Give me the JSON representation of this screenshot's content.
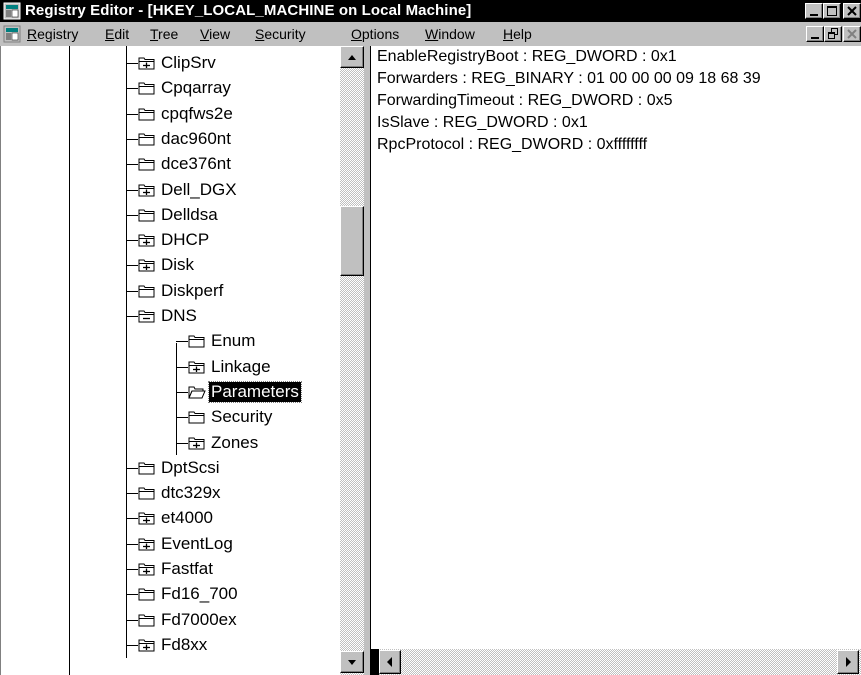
{
  "window": {
    "title": "Registry Editor - [HKEY_LOCAL_MACHINE on Local Machine]"
  },
  "menu": {
    "items": [
      {
        "label": "Registry",
        "accel": "R"
      },
      {
        "label": "Edit",
        "accel": "E"
      },
      {
        "label": "Tree",
        "accel": "T"
      },
      {
        "label": "View",
        "accel": "V"
      },
      {
        "label": "Security",
        "accel": "S"
      },
      {
        "label": "Options",
        "accel": "O"
      },
      {
        "label": "Window",
        "accel": "W"
      },
      {
        "label": "Help",
        "accel": "H"
      }
    ]
  },
  "tree": {
    "items": [
      {
        "label": "ClipSrv",
        "expander": "plus",
        "level": 0
      },
      {
        "label": "Cpqarray",
        "expander": "none",
        "level": 0
      },
      {
        "label": "cpqfws2e",
        "expander": "none",
        "level": 0
      },
      {
        "label": "dac960nt",
        "expander": "none",
        "level": 0
      },
      {
        "label": "dce376nt",
        "expander": "none",
        "level": 0
      },
      {
        "label": "Dell_DGX",
        "expander": "plus",
        "level": 0
      },
      {
        "label": "Delldsa",
        "expander": "none",
        "level": 0
      },
      {
        "label": "DHCP",
        "expander": "plus",
        "level": 0
      },
      {
        "label": "Disk",
        "expander": "plus",
        "level": 0
      },
      {
        "label": "Diskperf",
        "expander": "none",
        "level": 0
      },
      {
        "label": "DNS",
        "expander": "minus",
        "level": 0
      },
      {
        "label": "Enum",
        "expander": "none",
        "level": 1
      },
      {
        "label": "Linkage",
        "expander": "plus",
        "level": 1
      },
      {
        "label": "Parameters",
        "expander": "none",
        "level": 1,
        "selected": true
      },
      {
        "label": "Security",
        "expander": "none",
        "level": 1
      },
      {
        "label": "Zones",
        "expander": "plus",
        "level": 1
      },
      {
        "label": "DptScsi",
        "expander": "none",
        "level": 0
      },
      {
        "label": "dtc329x",
        "expander": "none",
        "level": 0
      },
      {
        "label": "et4000",
        "expander": "plus",
        "level": 0
      },
      {
        "label": "EventLog",
        "expander": "plus",
        "level": 0
      },
      {
        "label": "Fastfat",
        "expander": "plus",
        "level": 0
      },
      {
        "label": "Fd16_700",
        "expander": "none",
        "level": 0
      },
      {
        "label": "Fd7000ex",
        "expander": "none",
        "level": 0
      },
      {
        "label": "Fd8xx",
        "expander": "plus",
        "level": 0
      }
    ]
  },
  "values": [
    "EnableRegistryBoot : REG_DWORD : 0x1",
    "Forwarders : REG_BINARY : 01 00 00 00 09 18 68 39",
    "ForwardingTimeout : REG_DWORD : 0x5",
    "IsSlave : REG_DWORD : 0x1",
    "RpcProtocol : REG_DWORD : 0xffffffff"
  ],
  "colors": {
    "title_bg": "#000000",
    "face": "#c0c0c0",
    "selection": "#000000"
  }
}
